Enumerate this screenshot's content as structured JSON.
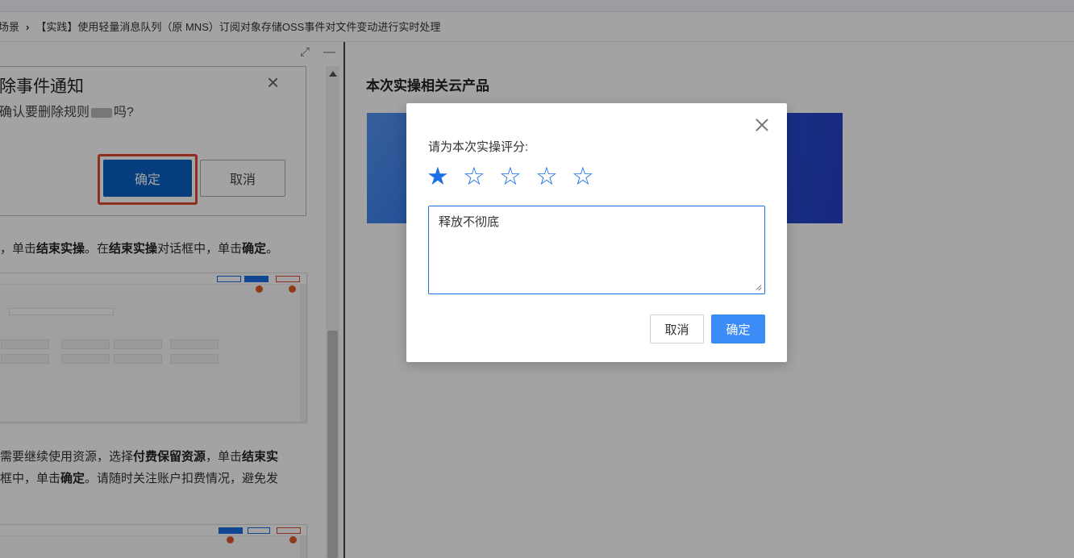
{
  "breadcrumb": {
    "parent": "场景",
    "separator": "›",
    "current": "【实践】使用轻量消息队列（原 MNS）订阅对象存储OSS事件对文件变动进行实时处理"
  },
  "left_panel": {
    "toolbar": {
      "expand_icon": "expand-icon",
      "minimize_icon": "minimize-icon"
    },
    "delete_dialog": {
      "title": "除事件通知",
      "close_glyph": "×",
      "message_before": "确认要删除规则",
      "message_after": "吗?",
      "confirm_label": "确定",
      "cancel_label": "取消"
    },
    "step_a": {
      "t1": "，单击",
      "b1": "结束实操",
      "t2": "。在",
      "b2": "结束实操",
      "t3": "对话框中，单击",
      "b3": "确定",
      "t4": "。"
    },
    "step_b_line1": {
      "t1": "需要继续使用资源，选择",
      "b1": "付费保留资源",
      "t2": "，单击",
      "b2": "结束实"
    },
    "step_b_line2": {
      "t1": "框中，单击",
      "b1": "确定",
      "t2": "。请随时关注账户扣费情况，避免发"
    }
  },
  "right_panel": {
    "title": "本次实操相关云产品"
  },
  "rating_modal": {
    "prompt": "请为本次实操评分:",
    "rating": 1,
    "max_rating": 5,
    "star_filled": "★",
    "star_empty": "☆",
    "comment_value": "释放不彻底",
    "cancel_label": "取消",
    "confirm_label": "确定",
    "accent_color": "#1a6fe6"
  }
}
